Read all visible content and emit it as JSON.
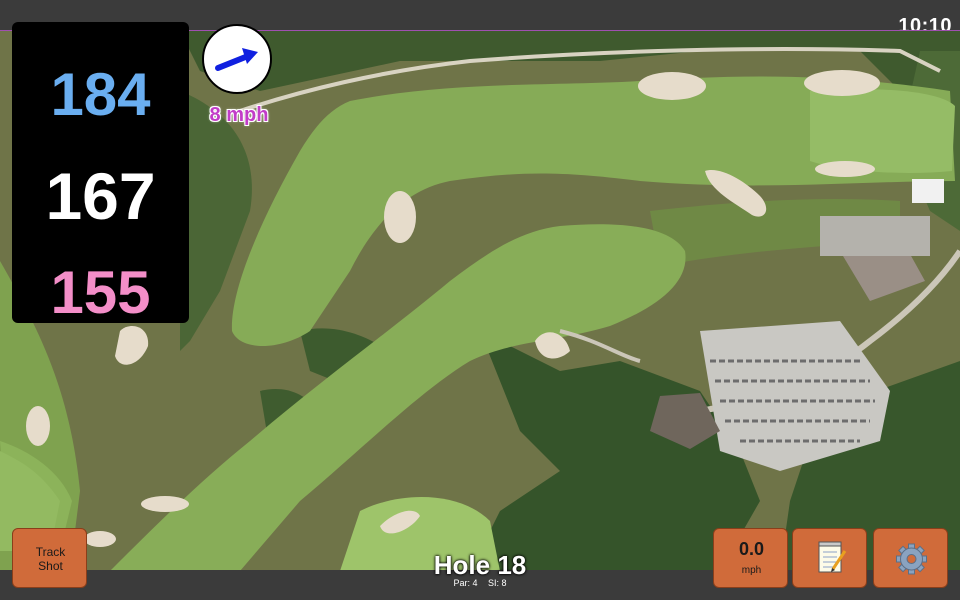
{
  "status_bar": {
    "time": "10:10"
  },
  "yardages": {
    "back": "184",
    "center": "167",
    "front": "155",
    "colors": {
      "back": "#6aaef0",
      "center": "#ffffff",
      "front": "#f38ec8"
    }
  },
  "wind": {
    "speed_label": "8 mph",
    "arrow_icon": "wind-direction-arrow-icon",
    "arrow_color": "#1020e0",
    "speed_color": "#c23cc8"
  },
  "map": {
    "type": "satellite-course-view"
  },
  "buttons": {
    "track_shot": {
      "label_line1": "Track",
      "label_line2": "Shot"
    },
    "speed": {
      "value": "0.0",
      "unit": "mph"
    },
    "notes": {
      "icon": "notepad-icon"
    },
    "settings": {
      "icon": "gear-icon"
    },
    "accent": "#d06b3a"
  },
  "hole": {
    "title": "Hole 18",
    "par": "Par: 4",
    "stroke_index": "SI: 8"
  }
}
